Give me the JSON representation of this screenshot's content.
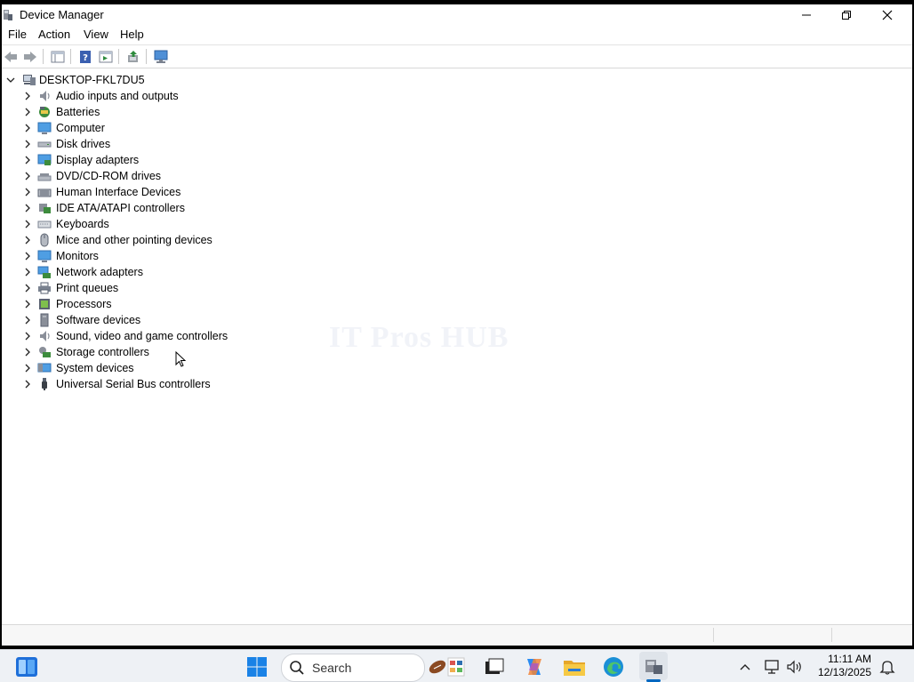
{
  "window": {
    "title": "Device Manager",
    "controls": {
      "minimize": "minimize-icon",
      "restore": "restore-icon",
      "close": "close-icon"
    }
  },
  "menu": [
    "File",
    "Action",
    "View",
    "Help"
  ],
  "toolbar": {
    "buttons": [
      "back-icon",
      "forward-icon",
      "show-hide-console-tree-icon",
      "help-icon",
      "properties-icon",
      "update-driver-icon",
      "scan-hardware-icon"
    ]
  },
  "tree": {
    "root": {
      "label": "DESKTOP-FKL7DU5",
      "expanded": true
    },
    "categories": [
      {
        "label": "Audio inputs and outputs",
        "icon": "speaker-icon"
      },
      {
        "label": "Batteries",
        "icon": "battery-icon"
      },
      {
        "label": "Computer",
        "icon": "computer-icon"
      },
      {
        "label": "Disk drives",
        "icon": "disk-drive-icon"
      },
      {
        "label": "Display adapters",
        "icon": "display-adapter-icon"
      },
      {
        "label": "DVD/CD-ROM drives",
        "icon": "dvd-drive-icon"
      },
      {
        "label": "Human Interface Devices",
        "icon": "hid-icon"
      },
      {
        "label": "IDE ATA/ATAPI controllers",
        "icon": "ide-controller-icon"
      },
      {
        "label": "Keyboards",
        "icon": "keyboard-icon"
      },
      {
        "label": "Mice and other pointing devices",
        "icon": "mouse-icon"
      },
      {
        "label": "Monitors",
        "icon": "monitor-icon"
      },
      {
        "label": "Network adapters",
        "icon": "network-adapter-icon"
      },
      {
        "label": "Print queues",
        "icon": "printer-icon"
      },
      {
        "label": "Processors",
        "icon": "processor-icon"
      },
      {
        "label": "Software devices",
        "icon": "software-device-icon"
      },
      {
        "label": "Sound, video and game controllers",
        "icon": "sound-icon"
      },
      {
        "label": "Storage controllers",
        "icon": "storage-controller-icon"
      },
      {
        "label": "System devices",
        "icon": "system-device-icon"
      },
      {
        "label": "Universal Serial Bus controllers",
        "icon": "usb-icon"
      }
    ]
  },
  "watermark": "IT Pros HUB",
  "taskbar": {
    "search_placeholder": "Search",
    "time": "11:11 AM",
    "date": "12/13/2025",
    "apps": [
      "widgets-icon",
      "start-icon",
      "search-icon",
      "football-icon",
      "task-view-icon",
      "copilot-icon",
      "file-explorer-icon",
      "edge-icon",
      "device-manager-taskbar-icon"
    ],
    "tray": [
      "chevron-up-icon",
      "network-icon",
      "volume-icon",
      "notification-icon"
    ]
  },
  "colors": {
    "accent": "#0067c0",
    "window_bg": "#ffffff",
    "taskbar_bg": "#eef1f5"
  }
}
